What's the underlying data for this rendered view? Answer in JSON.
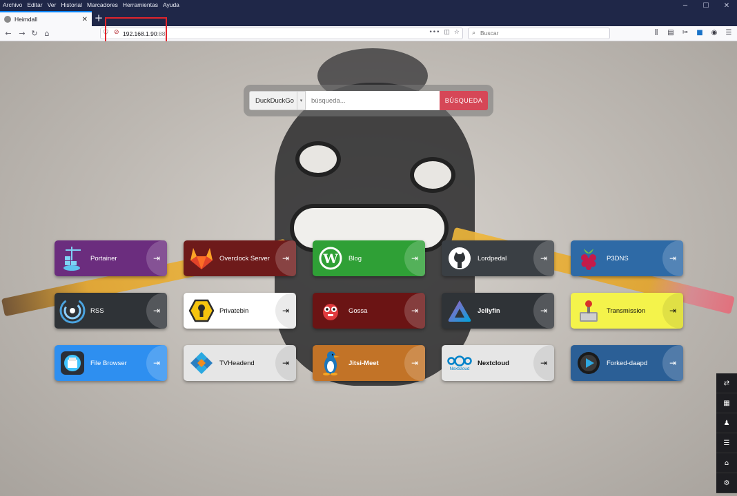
{
  "browser": {
    "menu": [
      "Archivo",
      "Editar",
      "Ver",
      "Historial",
      "Marcadores",
      "Herramientas",
      "Ayuda"
    ],
    "tab_title": "Heimdall",
    "url_host": "192.168.1.90",
    "url_port": ":88",
    "search_placeholder": "Buscar"
  },
  "search": {
    "provider": "DuckDuckGo",
    "placeholder": "búsqueda...",
    "button": "BÚSQUEDA"
  },
  "tiles": [
    {
      "label": "Portainer",
      "color": "#6b2d7e",
      "icon": "portainer-icon"
    },
    {
      "label": "Overclock Server",
      "color": "#6e1a1a",
      "icon": "gitlab-fox-icon"
    },
    {
      "label": "Blog",
      "color": "#2fa036",
      "icon": "wordpress-icon"
    },
    {
      "label": "Lordpedal",
      "color": "#3a3f44",
      "icon": "github-icon"
    },
    {
      "label": "P3DNS",
      "color": "#2e6aa6",
      "icon": "raspberry-pi-icon"
    },
    {
      "label": "RSS",
      "color": "#2f3337",
      "icon": "rss-icon"
    },
    {
      "label": "Privatebin",
      "color": "#ffffff",
      "icon": "privatebin-icon"
    },
    {
      "label": "Gossa",
      "color": "#6b1414",
      "icon": "gossa-icon"
    },
    {
      "label": "Jellyfin",
      "color": "#2f3337",
      "icon": "jellyfin-icon"
    },
    {
      "label": "Transmission",
      "color": "#f4f34b",
      "icon": "transmission-icon"
    },
    {
      "label": "File Browser",
      "color": "#2e8ff0",
      "icon": "file-browser-icon"
    },
    {
      "label": "TVHeadend",
      "color": "#e6e6e6",
      "icon": "tvheadend-icon"
    },
    {
      "label": "Jitsi-Meet",
      "color": "#c27327",
      "icon": "jitsi-icon"
    },
    {
      "label": "Nextcloud",
      "color": "#e6e6e6",
      "icon": "nextcloud-icon",
      "icon_caption": "Nextcloud"
    },
    {
      "label": "Forked-daapd",
      "color": "#2b5f96",
      "icon": "forked-daapd-icon"
    }
  ],
  "dock": [
    "swap-icon",
    "grid-icon",
    "user-icon",
    "list-icon",
    "tag-icon",
    "settings-icon"
  ]
}
